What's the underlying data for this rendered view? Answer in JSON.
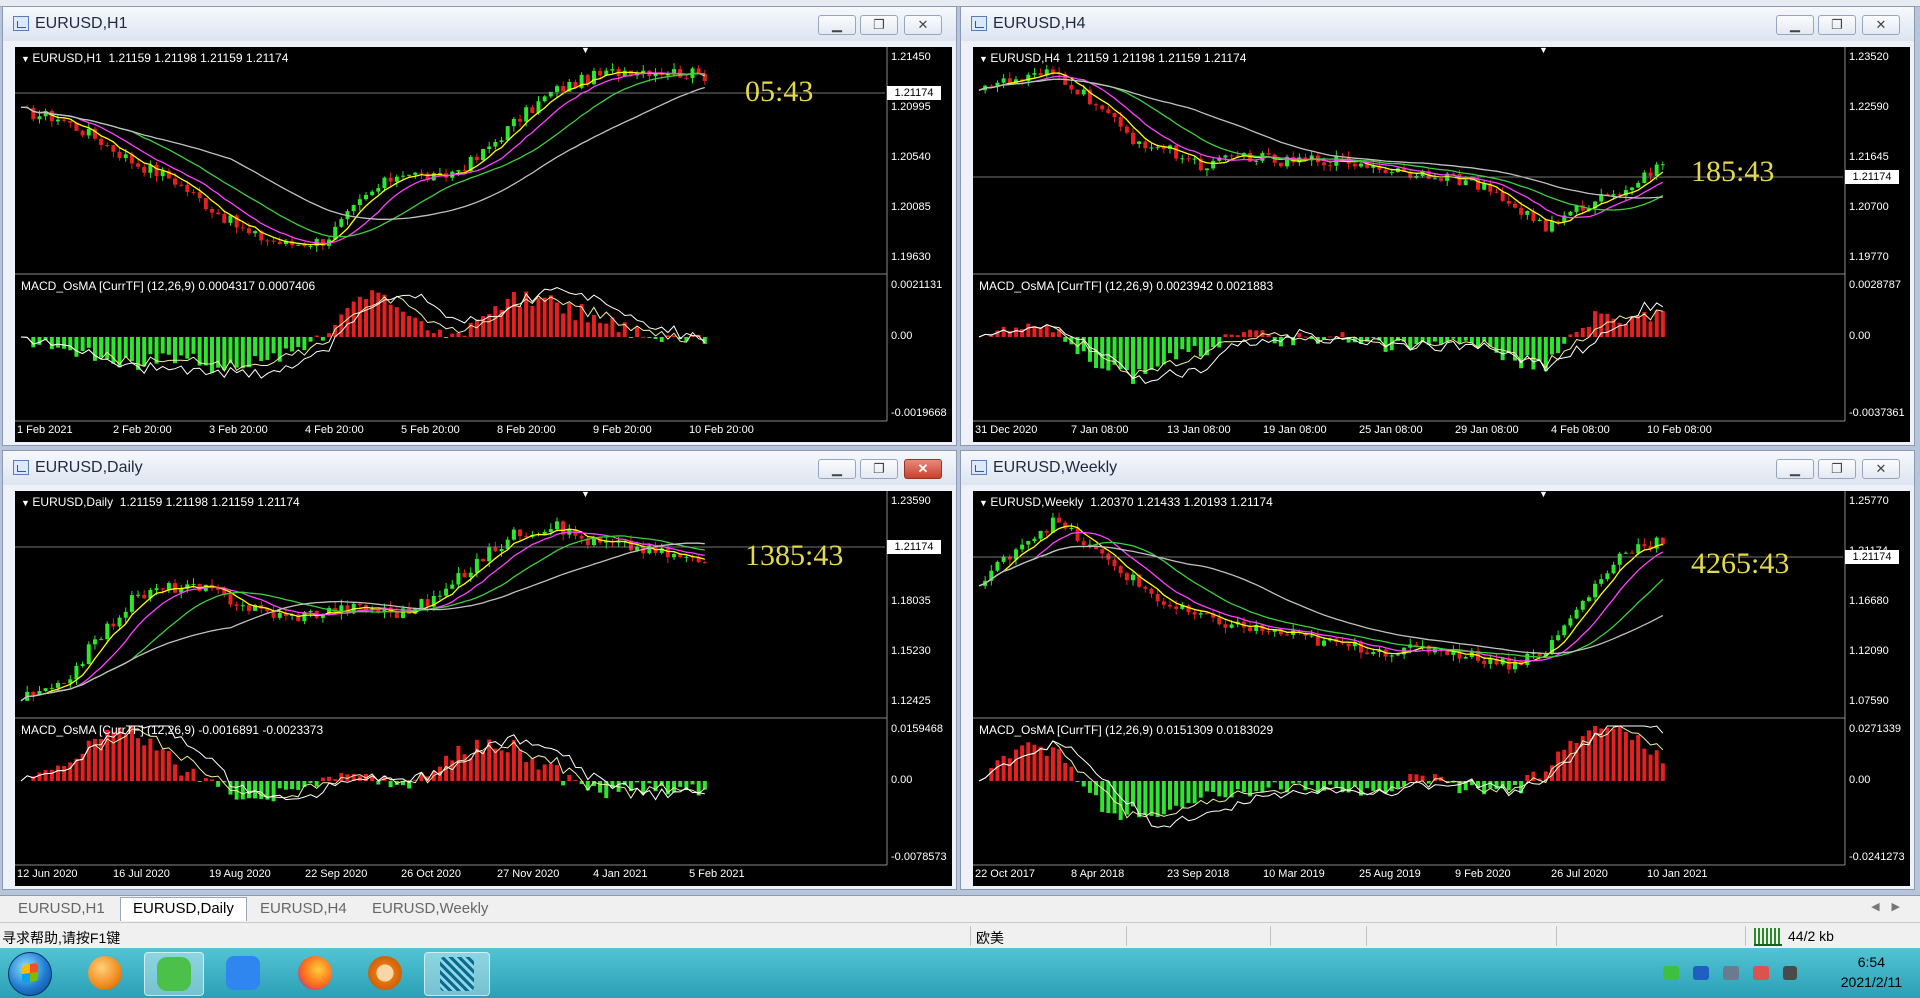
{
  "windows": [
    {
      "id": "h1",
      "title": "EURUSD,H1",
      "header": "EURUSD,H1  1.21159 1.21198 1.21159 1.21174",
      "price_axis": [
        "1.21450",
        "1.20995",
        "1.20540",
        "1.20085",
        "1.19630"
      ],
      "current_price": "1.21174",
      "countdown": "05:43",
      "macd_label": "MACD_OsMA [CurrTF] (12,26,9) 0.0004317 0.0007406",
      "macd_axis": [
        "0.0021131",
        "0.00",
        "-0.0019668"
      ],
      "dates": [
        "1 Feb 2021",
        "2 Feb 20:00",
        "3 Feb 20:00",
        "4 Feb 20:00",
        "5 Feb 20:00",
        "8 Feb 20:00",
        "9 Feb 20:00",
        "10 Feb 20:00"
      ],
      "close_active": false
    },
    {
      "id": "h4",
      "title": "EURUSD,H4",
      "header": "EURUSD,H4  1.21159 1.21198 1.21159 1.21174",
      "price_axis": [
        "1.23520",
        "1.22590",
        "1.21645",
        "1.20700",
        "1.19770"
      ],
      "current_price": "1.21174",
      "countdown": "185:43",
      "macd_label": "MACD_OsMA [CurrTF] (12,26,9) 0.0023942 0.0021883",
      "macd_axis": [
        "0.0028787",
        "0.00",
        "-0.0037361"
      ],
      "dates": [
        "31 Dec 2020",
        "7 Jan 08:00",
        "13 Jan 08:00",
        "19 Jan 08:00",
        "25 Jan 08:00",
        "29 Jan 08:00",
        "4 Feb 08:00",
        "10 Feb 08:00"
      ],
      "close_active": false
    },
    {
      "id": "daily",
      "title": "EURUSD,Daily",
      "header": "EURUSD,Daily  1.21159 1.21198 1.21159 1.21174",
      "price_axis": [
        "1.23590",
        "1.20785",
        "1.18035",
        "1.15230",
        "1.12425"
      ],
      "current_price": "1.21174",
      "countdown": "1385:43",
      "macd_label": "MACD_OsMA [CurrTF] (12,26,9) -0.0016891 -0.0023373",
      "macd_axis": [
        "0.0159468",
        "0.00",
        "-0.0078573"
      ],
      "dates": [
        "12 Jun 2020",
        "16 Jul 2020",
        "19 Aug 2020",
        "22 Sep 2020",
        "26 Oct 2020",
        "27 Nov 2020",
        "4 Jan 2021",
        "5 Feb 2021"
      ],
      "close_active": true
    },
    {
      "id": "weekly",
      "title": "EURUSD,Weekly",
      "header": "EURUSD,Weekly  1.20370 1.21433 1.20193 1.21174",
      "price_axis": [
        "1.25770",
        "1.21174",
        "1.16680",
        "1.12090",
        "1.07590"
      ],
      "current_price": "1.21174",
      "countdown": "4265:43",
      "macd_label": "MACD_OsMA [CurrTF] (12,26,9) 0.0151309 0.0183029",
      "macd_axis": [
        "0.0271339",
        "0.00",
        "-0.0241273"
      ],
      "dates": [
        "22 Oct 2017",
        "8 Apr 2018",
        "23 Sep 2018",
        "10 Mar 2019",
        "25 Aug 2019",
        "9 Feb 2020",
        "26 Jul 2020",
        "10 Jan 2021"
      ],
      "close_active": false
    }
  ],
  "window_buttons": {
    "minimize": "▁",
    "maximize": "❐",
    "close": "✕"
  },
  "tabs": [
    "EURUSD,H1",
    "EURUSD,Daily",
    "EURUSD,H4",
    "EURUSD,Weekly"
  ],
  "active_tab": "EURUSD,Daily",
  "statusbar": {
    "help": "寻求帮助,请按F1键",
    "profile": "欧美",
    "traffic": "44/2 kb"
  },
  "taskbar": {
    "time": "6:54",
    "date": "2021/2/11",
    "apps": [
      "start-menu",
      "refresh-app",
      "wechat",
      "feishu",
      "firefox",
      "panda-app",
      "mt4-terminal"
    ]
  },
  "colors": {
    "bull": "#2ee62e",
    "bear": "#e62020",
    "ma_fast": "#ffff00",
    "ma_mid": "#ff40ff",
    "ma_slow": "#3ecf3e",
    "ma_long": "#c0c0c0",
    "countdown": "#e4d94a"
  }
}
